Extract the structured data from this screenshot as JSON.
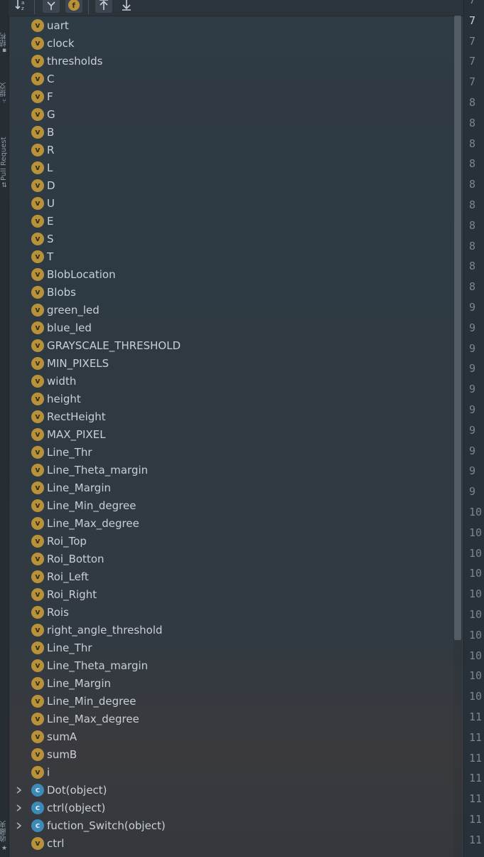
{
  "left_tabs": [
    {
      "label": "结构"
    },
    {
      "label": "提交"
    },
    {
      "label": "Pull Request"
    },
    {
      "label": "收藏夹"
    }
  ],
  "toolbar": {
    "buttons": [
      "sort-alpha-icon",
      "filter-icon",
      "fields-icon",
      "expand-all-icon",
      "collapse-all-icon"
    ]
  },
  "tree": {
    "items": [
      {
        "kind": "v",
        "label": "uart"
      },
      {
        "kind": "v",
        "label": "clock"
      },
      {
        "kind": "v",
        "label": "thresholds"
      },
      {
        "kind": "v",
        "label": "C"
      },
      {
        "kind": "v",
        "label": "F"
      },
      {
        "kind": "v",
        "label": "G"
      },
      {
        "kind": "v",
        "label": "B"
      },
      {
        "kind": "v",
        "label": "R"
      },
      {
        "kind": "v",
        "label": "L"
      },
      {
        "kind": "v",
        "label": "D"
      },
      {
        "kind": "v",
        "label": "U"
      },
      {
        "kind": "v",
        "label": "E"
      },
      {
        "kind": "v",
        "label": "S"
      },
      {
        "kind": "v",
        "label": "T"
      },
      {
        "kind": "v",
        "label": "BlobLocation"
      },
      {
        "kind": "v",
        "label": "Blobs"
      },
      {
        "kind": "v",
        "label": "green_led"
      },
      {
        "kind": "v",
        "label": "blue_led"
      },
      {
        "kind": "v",
        "label": "GRAYSCALE_THRESHOLD"
      },
      {
        "kind": "v",
        "label": "MIN_PIXELS"
      },
      {
        "kind": "v",
        "label": "width"
      },
      {
        "kind": "v",
        "label": "height"
      },
      {
        "kind": "v",
        "label": "RectHeight"
      },
      {
        "kind": "v",
        "label": "MAX_PIXEL"
      },
      {
        "kind": "v",
        "label": "Line_Thr"
      },
      {
        "kind": "v",
        "label": "Line_Theta_margin"
      },
      {
        "kind": "v",
        "label": "Line_Margin"
      },
      {
        "kind": "v",
        "label": "Line_Min_degree"
      },
      {
        "kind": "v",
        "label": "Line_Max_degree"
      },
      {
        "kind": "v",
        "label": "Roi_Top"
      },
      {
        "kind": "v",
        "label": "Roi_Botton"
      },
      {
        "kind": "v",
        "label": "Roi_Left"
      },
      {
        "kind": "v",
        "label": "Roi_Right"
      },
      {
        "kind": "v",
        "label": "Rois"
      },
      {
        "kind": "v",
        "label": "right_angle_threshold"
      },
      {
        "kind": "v",
        "label": "Line_Thr"
      },
      {
        "kind": "v",
        "label": "Line_Theta_margin"
      },
      {
        "kind": "v",
        "label": "Line_Margin"
      },
      {
        "kind": "v",
        "label": "Line_Min_degree"
      },
      {
        "kind": "v",
        "label": "Line_Max_degree"
      },
      {
        "kind": "v",
        "label": "sumA"
      },
      {
        "kind": "v",
        "label": "sumB"
      },
      {
        "kind": "v",
        "label": "i"
      },
      {
        "kind": "c",
        "label": "Dot(object)",
        "expandable": true
      },
      {
        "kind": "c",
        "label": "ctrl(object)",
        "expandable": true
      },
      {
        "kind": "c",
        "label": "fuction_Switch(object)",
        "expandable": true
      },
      {
        "kind": "v",
        "label": "ctrl"
      }
    ]
  },
  "gutter": {
    "line_numbers": [
      "7",
      "7",
      "7",
      "7",
      "7",
      "8",
      "8",
      "8",
      "8",
      "8",
      "8",
      "8",
      "8",
      "8",
      "8",
      "9",
      "9",
      "9",
      "9",
      "9",
      "9",
      "9",
      "9",
      "9",
      "9",
      "10",
      "10",
      "10",
      "10",
      "10",
      "10",
      "10",
      "10",
      "10",
      "10",
      "11",
      "11",
      "11",
      "11",
      "11",
      "11",
      "11"
    ],
    "active_index": 1
  },
  "colors": {
    "variable_badge": "#b8923a",
    "class_badge": "#3d8ab8",
    "text": "#c9cfd6"
  }
}
